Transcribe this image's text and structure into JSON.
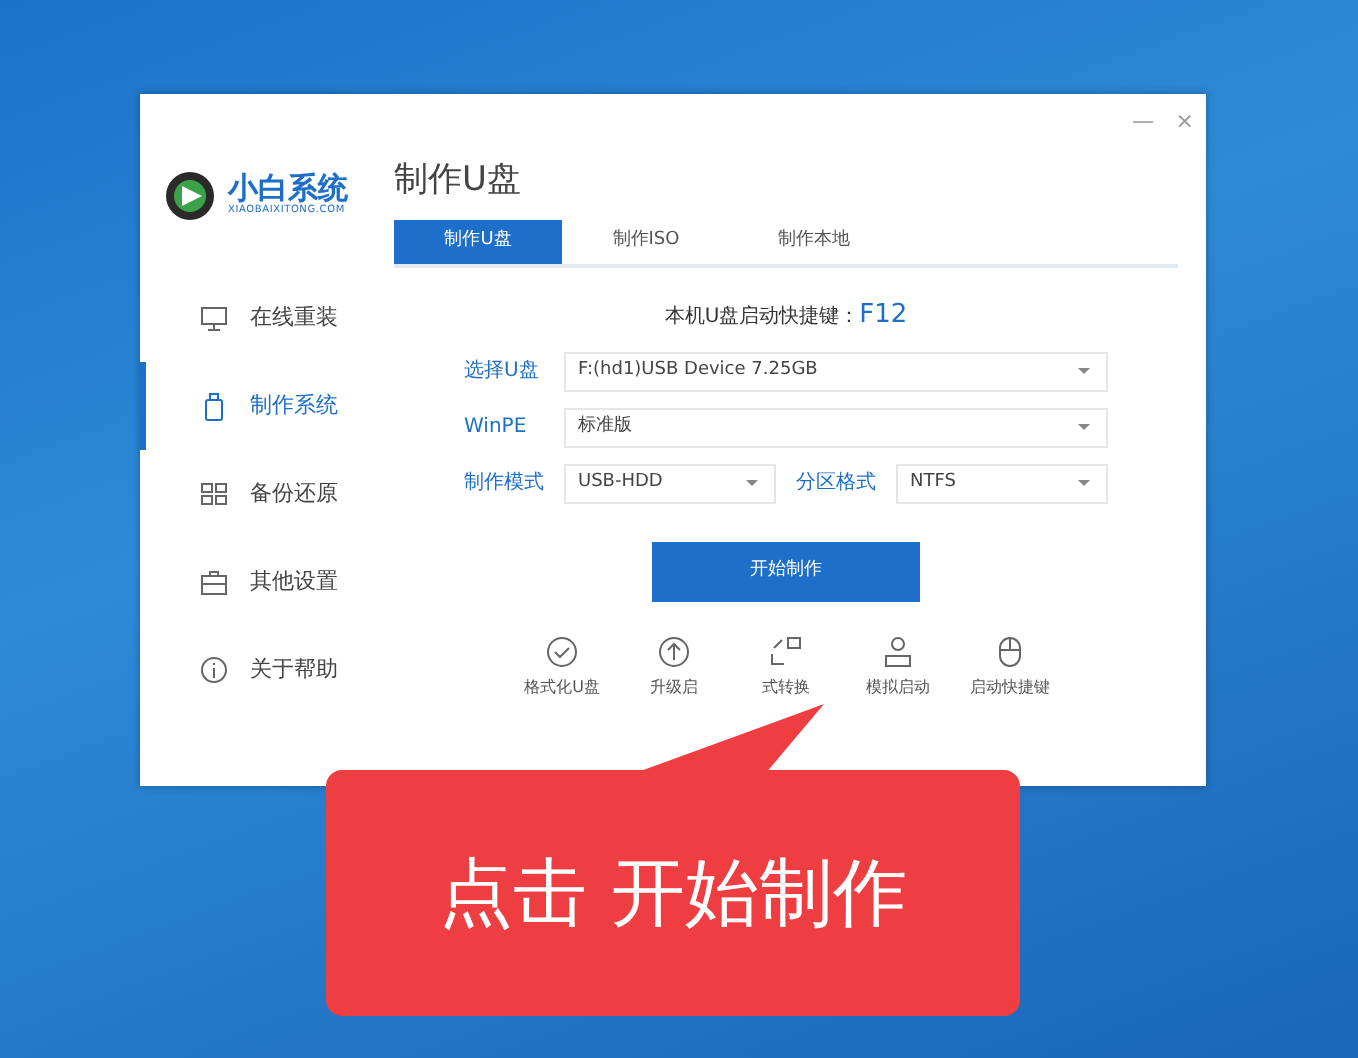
{
  "window": {
    "controls": [
      "—",
      "×"
    ]
  },
  "logo": {
    "name": "小白系统",
    "url": "XIAOBAIXITONG.COM"
  },
  "sidebar": {
    "items": [
      {
        "label": "在线重装",
        "selected": false
      },
      {
        "label": "制作系统",
        "selected": true
      },
      {
        "label": "备份还原",
        "selected": false
      },
      {
        "label": "其他设置",
        "selected": false
      },
      {
        "label": "关于帮助",
        "selected": false
      }
    ]
  },
  "page_title": "制作U盘",
  "tabs": [
    {
      "label": "制作U盘",
      "selected": true
    },
    {
      "label": "制作ISO",
      "selected": false
    },
    {
      "label": "制作本地",
      "selected": false
    }
  ],
  "hotkey": {
    "label": "本机U盘启动快捷键：",
    "key": "F12"
  },
  "fields": [
    {
      "label": "选择U盘",
      "value": "F:(hd1)USB Device 7.25GB"
    },
    {
      "label": "WinPE",
      "value": "标准版"
    }
  ],
  "mode_row": [
    {
      "label": "制作模式",
      "value": "USB-HDD"
    },
    {
      "label": "分区格式",
      "value": "NTFS"
    }
  ],
  "start_button": "开始制作",
  "tools": [
    {
      "label": "格式化U盘"
    },
    {
      "label": "升级启"
    },
    {
      "label": "式转换"
    },
    {
      "label": "模拟启动"
    },
    {
      "label": "启动快捷键"
    }
  ],
  "callout": {
    "text": "点击 开始制作"
  }
}
